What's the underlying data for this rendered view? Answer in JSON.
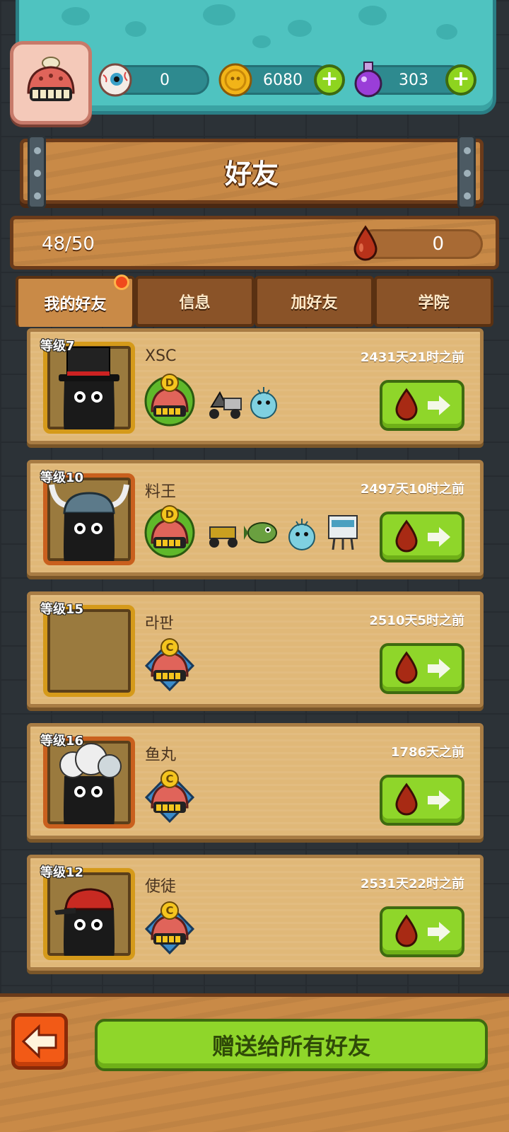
{
  "resources": {
    "eyes": "0",
    "coins": "6080",
    "potions": "303"
  },
  "title": "好友",
  "stats": {
    "friend_count": "48/50",
    "blood_drops": "0"
  },
  "tabs": [
    {
      "label": "我的好友",
      "active": true,
      "badge": true
    },
    {
      "label": "信息",
      "active": false
    },
    {
      "label": "加好友",
      "active": false
    },
    {
      "label": "学院",
      "active": false
    }
  ],
  "friends": [
    {
      "level": "等级7",
      "name": "XSC",
      "time": "2431天21时之前",
      "rank": "D",
      "hat": "top-hat",
      "frame": "gold",
      "pets": [
        "scooter-icon",
        "pufferfish-icon"
      ]
    },
    {
      "level": "等级10",
      "name": "料王",
      "time": "2497天10时之前",
      "rank": "D",
      "hat": "viking-helmet",
      "frame": "orange",
      "pets": [
        "buggy-icon",
        "fish-bot-icon",
        "pufferfish-icon",
        "robot-icon"
      ]
    },
    {
      "level": "等级15",
      "name": "라판",
      "time": "2510天5时之前",
      "rank": "C",
      "hat": "none",
      "frame": "gold",
      "pets": []
    },
    {
      "level": "等级16",
      "name": "鱼丸",
      "time": "1786天之前",
      "rank": "C",
      "hat": "cloud-hair",
      "frame": "orange",
      "pets": []
    },
    {
      "level": "等级12",
      "name": "使徒",
      "time": "2531天22时之前",
      "rank": "C",
      "hat": "red-cap",
      "frame": "gold",
      "pets": []
    }
  ],
  "bottom": {
    "send_all_label": "赠送给所有好友"
  },
  "colors": {
    "accent_green": "#8fd62a",
    "wood": "#c98a47",
    "teal_panel": "#4fc3c0",
    "back_orange": "#f25a16"
  }
}
